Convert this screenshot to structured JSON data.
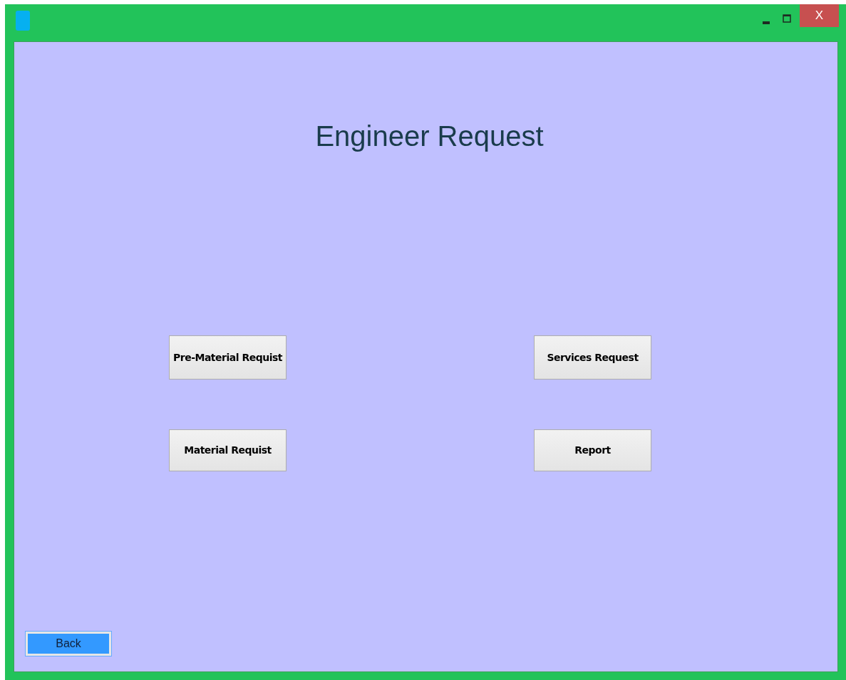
{
  "window": {
    "close_label": "X"
  },
  "title": "Engineer Request",
  "buttons": [
    {
      "label": "Pre-Material Requist"
    },
    {
      "label": "Services Request"
    },
    {
      "label": "Material Requist"
    },
    {
      "label": "Report"
    }
  ],
  "back_button": {
    "label": "Back"
  }
}
